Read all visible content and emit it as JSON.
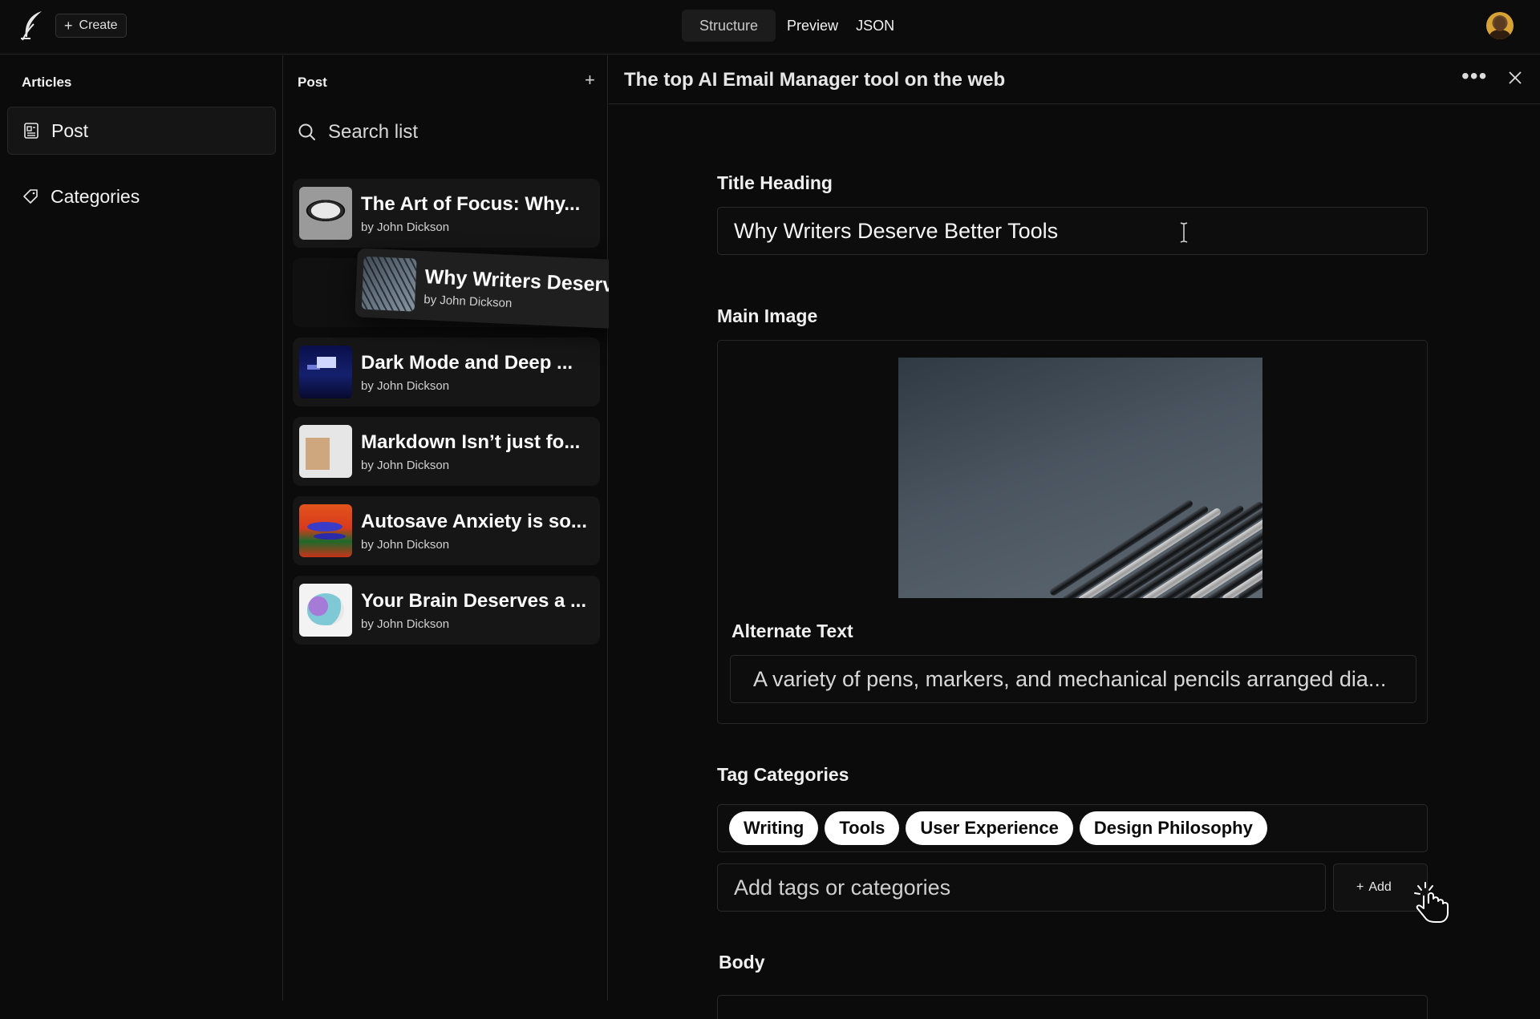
{
  "topbar": {
    "create_label": "Create",
    "tabs": [
      {
        "label": "Structure",
        "active": true
      },
      {
        "label": "Preview",
        "active": false
      },
      {
        "label": "JSON",
        "active": false
      }
    ]
  },
  "sidebar": {
    "title": "Articles",
    "items": [
      {
        "label": "Post",
        "icon": "document-icon",
        "selected": true
      },
      {
        "label": "Categories",
        "icon": "tag-icon",
        "selected": false
      }
    ]
  },
  "list": {
    "title": "Post",
    "search_placeholder": "Search list",
    "posts": [
      {
        "title": "The Art of Focus: Why...",
        "author": "by John Dickson"
      },
      {
        "title": "Dark Mode and Deep ...",
        "author": "by John Dickson"
      },
      {
        "title": "Markdown Isn’t just fo...",
        "author": "by John Dickson"
      },
      {
        "title": "Autosave Anxiety is so...",
        "author": "by John Dickson"
      },
      {
        "title": "Your Brain Deserves a ...",
        "author": "by John Dickson"
      }
    ],
    "dragging": {
      "title": "Why Writers Deserve ...",
      "author": "by John Dickson"
    }
  },
  "editor": {
    "doc_title": "The top AI Email Manager tool on the web",
    "title_heading_label": "Title Heading",
    "title_heading_value": "Why Writers Deserve Better Tools",
    "main_image_label": "Main Image",
    "alt_text_label": "Alternate Text",
    "alt_text_value": "A variety of pens, markers, and mechanical pencils arranged dia...",
    "tag_categories_label": "Tag Categories",
    "tags": [
      "Writing",
      "Tools",
      "User Experience",
      "Design Philosophy"
    ],
    "add_tags_placeholder": "Add tags or categories",
    "add_label": "Add",
    "body_label": "Body"
  },
  "colors": {
    "background": "#0b0b0b",
    "panel_border": "#262626",
    "card": "#161616",
    "pill": "#ffffff"
  }
}
